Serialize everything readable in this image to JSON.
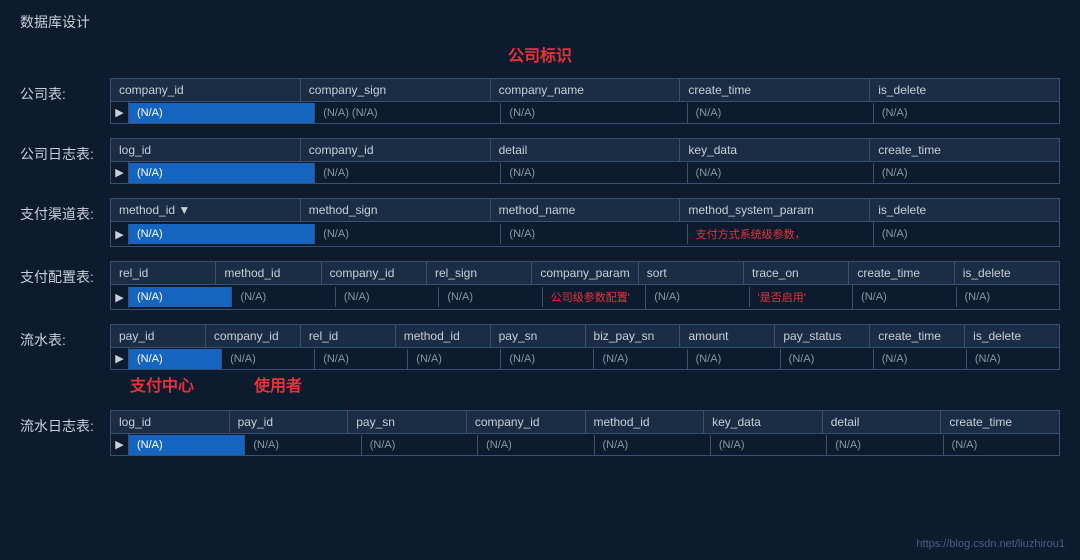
{
  "pageTitle": "数据库设计",
  "centerLabel": "公司标识",
  "watermark": "https://blog.csdn.net/liuzhirou1",
  "tables": [
    {
      "label": "公司表:",
      "columns": [
        "company_id",
        "company_sign",
        "company_name",
        "create_time",
        "is_delete"
      ],
      "row": [
        {
          "text": "(N/A)",
          "selected": true
        },
        {
          "text": "(N/A) (N/A)",
          "selected": false
        },
        {
          "text": "(N/A)",
          "selected": false
        },
        {
          "text": "(N/A)",
          "selected": false
        },
        {
          "text": "(N/A)",
          "selected": false
        }
      ]
    },
    {
      "label": "公司日志表:",
      "columns": [
        "log_id",
        "company_id",
        "detail",
        "key_data",
        "create_time"
      ],
      "row": [
        {
          "text": "(N/A)",
          "selected": true
        },
        {
          "text": "(N/A)",
          "selected": false
        },
        {
          "text": "(N/A)",
          "selected": false
        },
        {
          "text": "(N/A)",
          "selected": false
        },
        {
          "text": "(N/A)",
          "selected": false
        }
      ]
    },
    {
      "label": "支付渠道表:",
      "columns": [
        "method_id ▼",
        "method_sign",
        "method_name",
        "method_system_param",
        "is_delete"
      ],
      "row": [
        {
          "text": "(N/A)",
          "selected": true
        },
        {
          "text": "(N/A)",
          "selected": false
        },
        {
          "text": "(N/A)",
          "selected": false
        },
        {
          "text": "支付方式系统级参数，",
          "selected": false,
          "red": true
        },
        {
          "text": "(N/A)",
          "selected": false
        }
      ]
    },
    {
      "label": "支付配置表:",
      "columns": [
        "rel_id",
        "method_id",
        "company_id",
        "rel_sign",
        "company_param",
        "sort",
        "trace_on",
        "create_time",
        "is_delete"
      ],
      "row": [
        {
          "text": "(N/A)",
          "selected": true
        },
        {
          "text": "(N/A)",
          "selected": false
        },
        {
          "text": "(N/A)",
          "selected": false
        },
        {
          "text": "(N/A)",
          "selected": false
        },
        {
          "text": "公司级参数配置'",
          "selected": false,
          "red": true
        },
        {
          "text": "(N/A)",
          "selected": false
        },
        {
          "text": "'是否启用'",
          "selected": false,
          "red": true
        },
        {
          "text": "(N/A)",
          "selected": false
        },
        {
          "text": "(N/A)",
          "selected": false
        }
      ]
    },
    {
      "label": "流水表:",
      "columns": [
        "pay_id",
        "company_id",
        "rel_id",
        "method_id",
        "pay_sn",
        "biz_pay_sn",
        "amount",
        "pay_status",
        "create_time",
        "is_delete"
      ],
      "row": [
        {
          "text": "(N/A)",
          "selected": true
        },
        {
          "text": "(N/A)",
          "selected": false
        },
        {
          "text": "(N/A)",
          "selected": false
        },
        {
          "text": "(N/A)",
          "selected": false
        },
        {
          "text": "(N/A)",
          "selected": false
        },
        {
          "text": "(N/A)",
          "selected": false
        },
        {
          "text": "(N/A)",
          "selected": false
        },
        {
          "text": "(N/A)",
          "selected": false
        },
        {
          "text": "(N/A)",
          "selected": false
        },
        {
          "text": "(N/A)",
          "selected": false
        }
      ],
      "subLabels": [
        "支付中心",
        "使用者"
      ]
    },
    {
      "label": "流水日志表:",
      "columns": [
        "log_id",
        "pay_id",
        "pay_sn",
        "company_id",
        "method_id",
        "key_data",
        "detail",
        "create_time"
      ],
      "row": [
        {
          "text": "(N/A)",
          "selected": true
        },
        {
          "text": "(N/A)",
          "selected": false
        },
        {
          "text": "(N/A)",
          "selected": false
        },
        {
          "text": "(N/A)",
          "selected": false
        },
        {
          "text": "(N/A)",
          "selected": false
        },
        {
          "text": "(N/A)",
          "selected": false
        },
        {
          "text": "(N/A)",
          "selected": false
        },
        {
          "text": "(N/A)",
          "selected": false
        }
      ]
    }
  ]
}
